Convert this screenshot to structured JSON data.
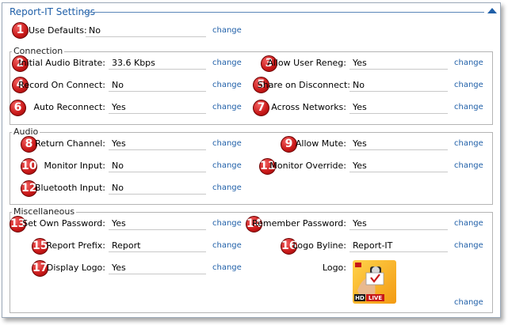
{
  "title": "Report-IT Settings",
  "change_label": "change",
  "use_defaults": {
    "label": "Use Defaults:",
    "value": "No",
    "badge": "1"
  },
  "connection": {
    "label": "Connection",
    "initial_audio_bitrate": {
      "label": "Initial Audio Bitrate:",
      "value": "33.6 Kbps",
      "badge": "2"
    },
    "allow_user_reneg": {
      "label": "Allow User Reneg:",
      "value": "Yes",
      "badge": "3"
    },
    "record_on_connect": {
      "label": "Record On Connect:",
      "value": "No",
      "badge": "4"
    },
    "share_on_disconnect": {
      "label": "Share on Disconnect:",
      "value": "No",
      "badge": "5"
    },
    "auto_reconnect": {
      "label": "Auto Reconnect:",
      "value": "Yes",
      "badge": "6"
    },
    "across_networks": {
      "label": "Across Networks:",
      "value": "Yes",
      "badge": "7"
    }
  },
  "audio": {
    "label": "Audio",
    "return_channel": {
      "label": "Return Channel:",
      "value": "Yes",
      "badge": "8"
    },
    "allow_mute": {
      "label": "Allow Mute:",
      "value": "Yes",
      "badge": "9"
    },
    "monitor_input": {
      "label": "Monitor Input:",
      "value": "No",
      "badge": "10"
    },
    "monitor_override": {
      "label": "Monitor Override:",
      "value": "Yes",
      "badge": "11"
    },
    "bluetooth_input": {
      "label": "Bluetooth Input:",
      "value": "No",
      "badge": "12"
    }
  },
  "misc": {
    "label": "Miscellaneous",
    "set_own_password": {
      "label": "Set Own Password:",
      "value": "Yes",
      "badge": "13"
    },
    "remember_password": {
      "label": "Remember Password:",
      "value": "Yes",
      "badge": "14"
    },
    "report_prefix": {
      "label": "Report Prefix:",
      "value": "Report",
      "badge": "15"
    },
    "logo_byline": {
      "label": "Logo Byline:",
      "value": "Report-IT",
      "badge": "16"
    },
    "display_logo": {
      "label": "Display Logo:",
      "value": "Yes",
      "badge": "17"
    },
    "logo": {
      "label": "Logo:",
      "hd_text": "HD",
      "live_text": "LIVE"
    }
  },
  "colors": {
    "accent": "#1f5fa8",
    "badge_red": "#c81818"
  }
}
